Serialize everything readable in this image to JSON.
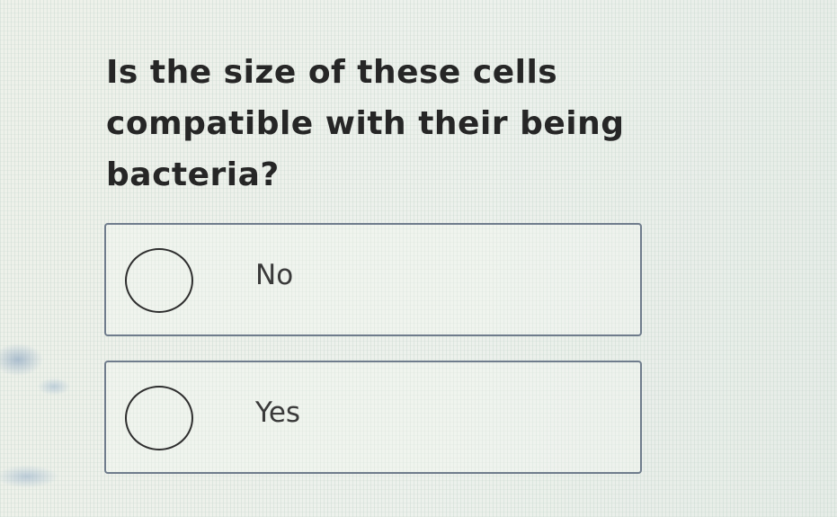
{
  "question": {
    "text": "Is the size of these cells compatible with their being bacteria?"
  },
  "options": [
    {
      "label": "No",
      "selected": false
    },
    {
      "label": "Yes",
      "selected": false
    }
  ]
}
